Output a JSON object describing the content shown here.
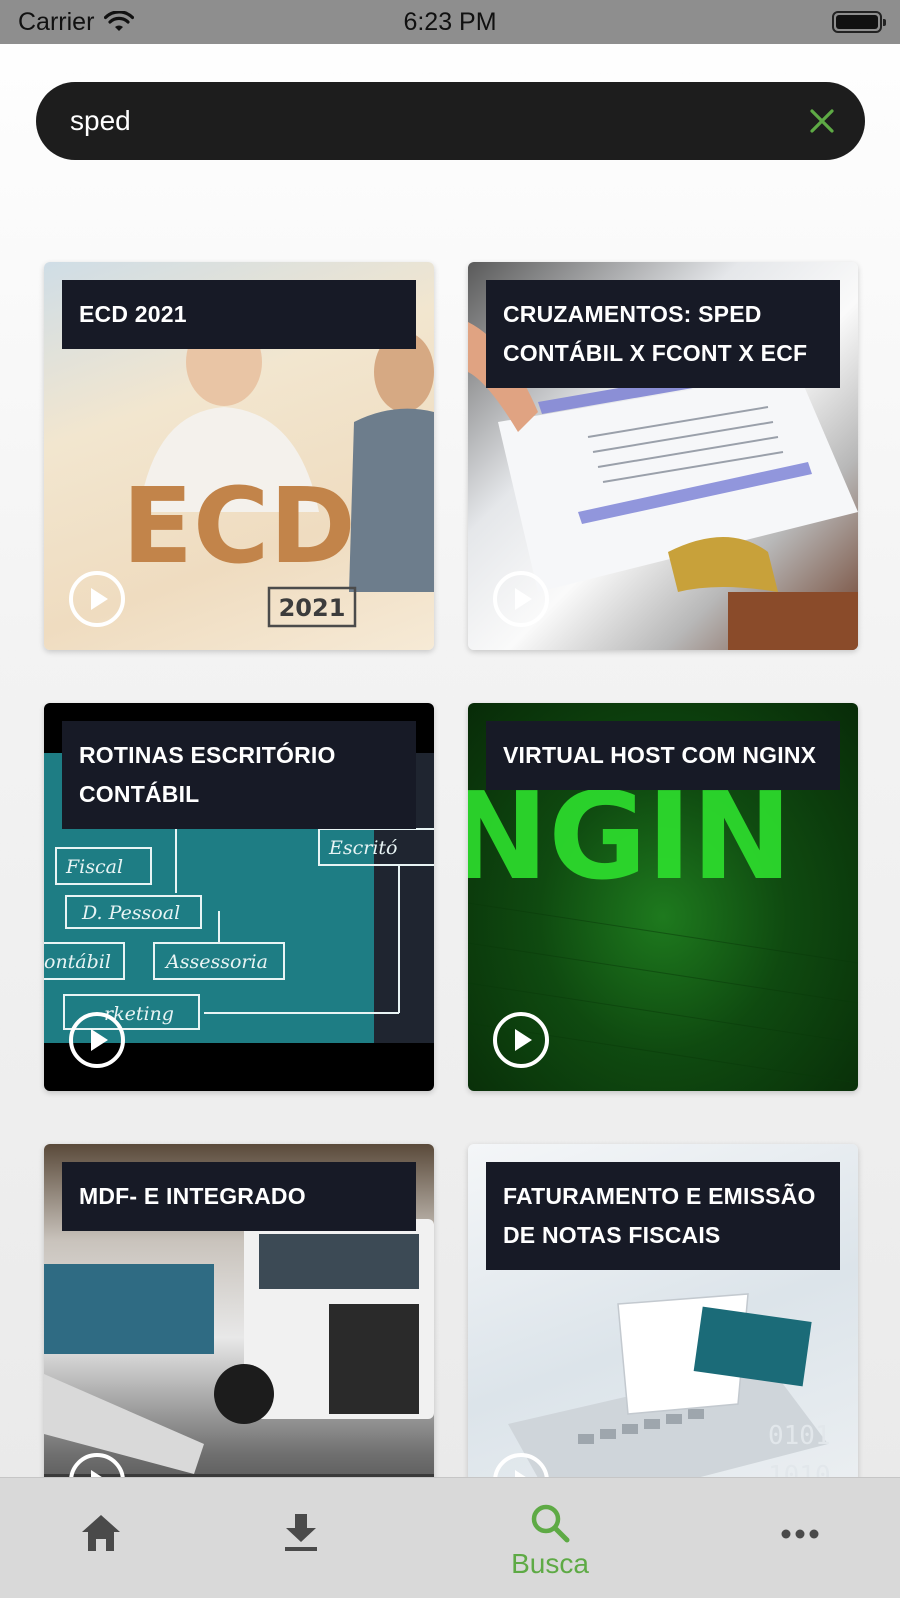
{
  "status_bar": {
    "carrier": "Carrier",
    "time": "6:23 PM"
  },
  "search": {
    "value": "sped",
    "clear_icon": "close-icon",
    "accent": "#5eaa45"
  },
  "results": [
    {
      "title": "ECD 2021",
      "thumb_text": "ECD",
      "thumb_year": "2021"
    },
    {
      "title": "CRUZAMENTOS: SPED CONTÁBIL X FCONT X ECF"
    },
    {
      "title": "ROTINAS ESCRITÓRIO CONTÁBIL",
      "thumb_labels": [
        "Fiscal",
        "D. Pessoal",
        "ontábil",
        "Assessoria",
        "rketing",
        "Escritó"
      ]
    },
    {
      "title": "VIRTUAL HOST COM NGINX",
      "thumb_text": "NGIN"
    },
    {
      "title": "MDF- E INTEGRADO"
    },
    {
      "title": "FATURAMENTO E EMISSÃO DE NOTAS FISCAIS"
    }
  ],
  "tab_bar": {
    "tabs": [
      {
        "icon": "home-icon",
        "label": ""
      },
      {
        "icon": "download-icon",
        "label": ""
      },
      {
        "icon": "search-icon",
        "label": "Busca",
        "active": true
      },
      {
        "icon": "more-icon",
        "label": ""
      }
    ],
    "active_color": "#5eaa45",
    "inactive_color": "#4a4a4a"
  }
}
